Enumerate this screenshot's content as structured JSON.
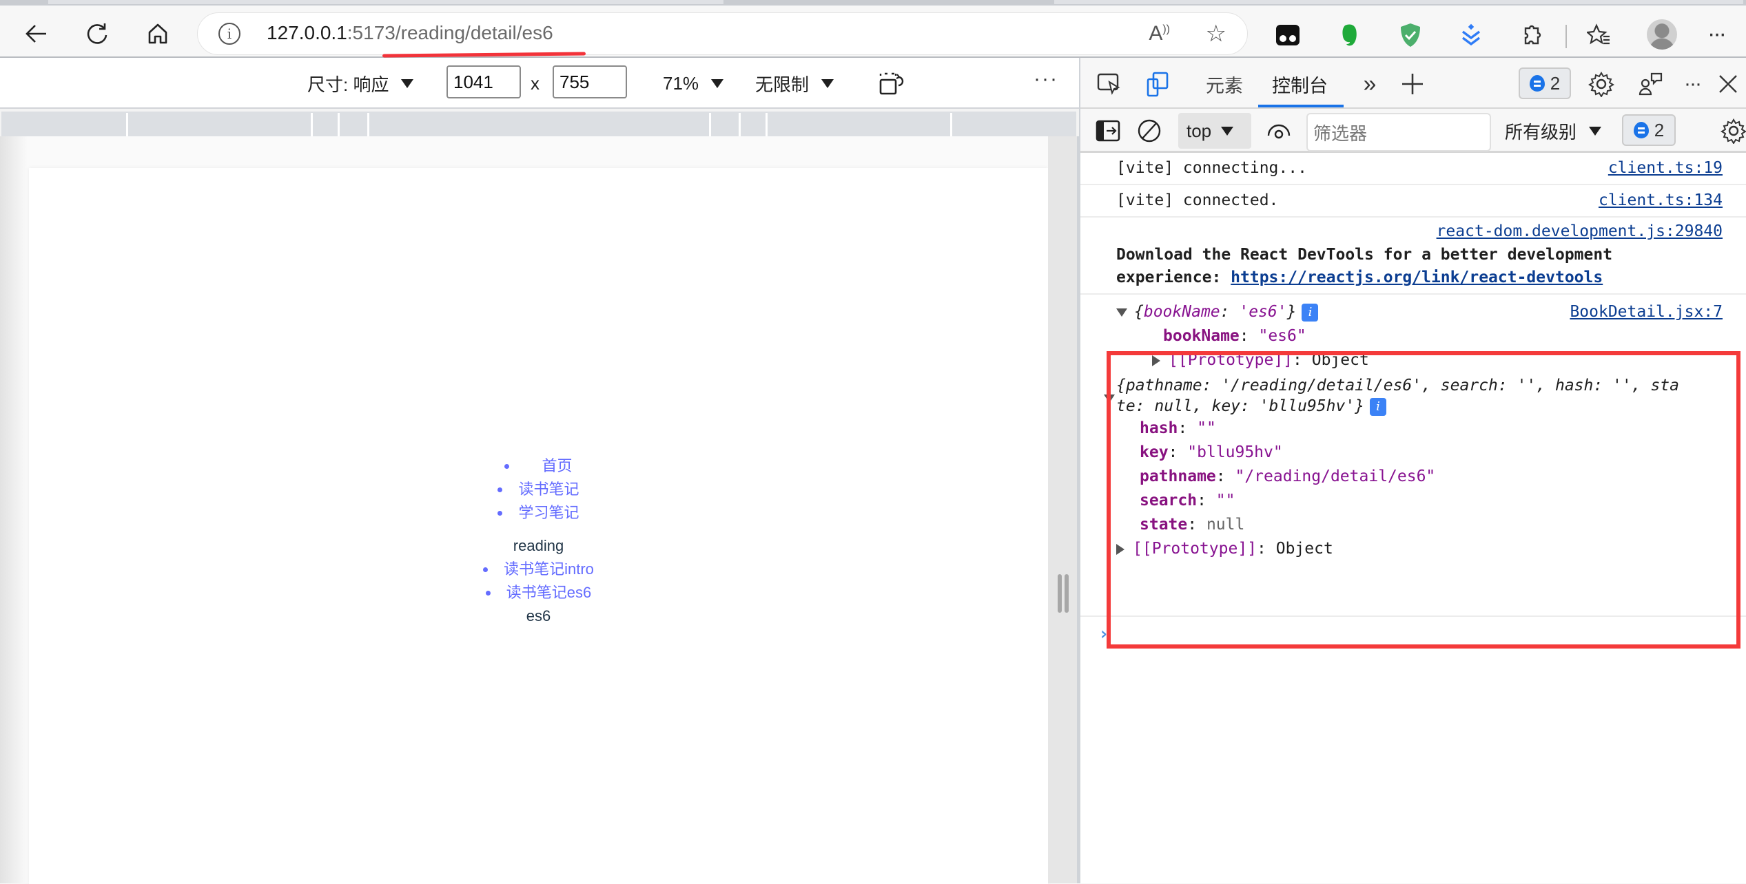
{
  "browser": {
    "url_host": "127.0.0.1",
    "url_rest": ":5173/reading/detail/es6",
    "read_aloud_icon": "read-aloud-icon",
    "favorite_icon": "add-favorite-icon",
    "extensions": [
      "tampermonkey-extension-icon",
      "evernote-extension-icon",
      "adguard-extension-icon",
      "download-extension-icon",
      "extensions-puzzle-icon"
    ],
    "favorites_icon": "favorites-icon",
    "more": "···"
  },
  "device_toolbar": {
    "size_label": "尺寸: 响应",
    "width": "1041",
    "times": "x",
    "height": "755",
    "zoom": "71%",
    "throttle": "无限制",
    "more": "···"
  },
  "page": {
    "nav": [
      "首页",
      "读书笔记",
      "学习笔记"
    ],
    "section_title": "reading",
    "sub_nav": [
      "读书笔记intro",
      "读书笔记es6"
    ],
    "detail": "es6"
  },
  "devtools": {
    "tabs": [
      {
        "label": "元素",
        "active": false
      },
      {
        "label": "控制台",
        "active": true
      }
    ],
    "issue_count": "2",
    "console_toolbar": {
      "context": "top",
      "filter_placeholder": "筛选器",
      "levels": "所有级别",
      "issue_count": "2"
    },
    "messages": [
      {
        "text": "[vite] connecting...",
        "source": "client.ts:19"
      },
      {
        "text": "[vite] connected.",
        "source": "client.ts:134"
      },
      {
        "source": "react-dom.development.js:29840",
        "text_line1": "Download the React DevTools for a better development",
        "text_line2_prefix": "experience: ",
        "link": "https://reactjs.org/link/react-devtools"
      }
    ],
    "object1": {
      "summary_open": "{",
      "summary_key": "bookName",
      "summary_val": "'es6'",
      "summary_close": "}",
      "source": "BookDetail.jsx:7",
      "props": [
        {
          "key": "bookName",
          "value": "\"es6\""
        }
      ],
      "prototype": "[[Prototype]]",
      "prototype_value": "Object"
    },
    "object2": {
      "summary_line1": "{pathname: '/reading/detail/es6', search: '', hash: '', sta",
      "summary_line2": "te: null, key: 'bllu95hv'}",
      "props": [
        {
          "key": "hash",
          "value": "\"\"",
          "type": "str"
        },
        {
          "key": "key",
          "value": "\"bllu95hv\"",
          "type": "str"
        },
        {
          "key": "pathname",
          "value": "\"/reading/detail/es6\"",
          "type": "str"
        },
        {
          "key": "search",
          "value": "\"\"",
          "type": "str"
        },
        {
          "key": "state",
          "value": "null",
          "type": "null"
        }
      ],
      "prototype": "[[Prototype]]",
      "prototype_value": "Object"
    },
    "prompt": "›"
  },
  "annotations": {
    "highlight_color": "#f43a3a",
    "underline_color": "#f2333a"
  }
}
